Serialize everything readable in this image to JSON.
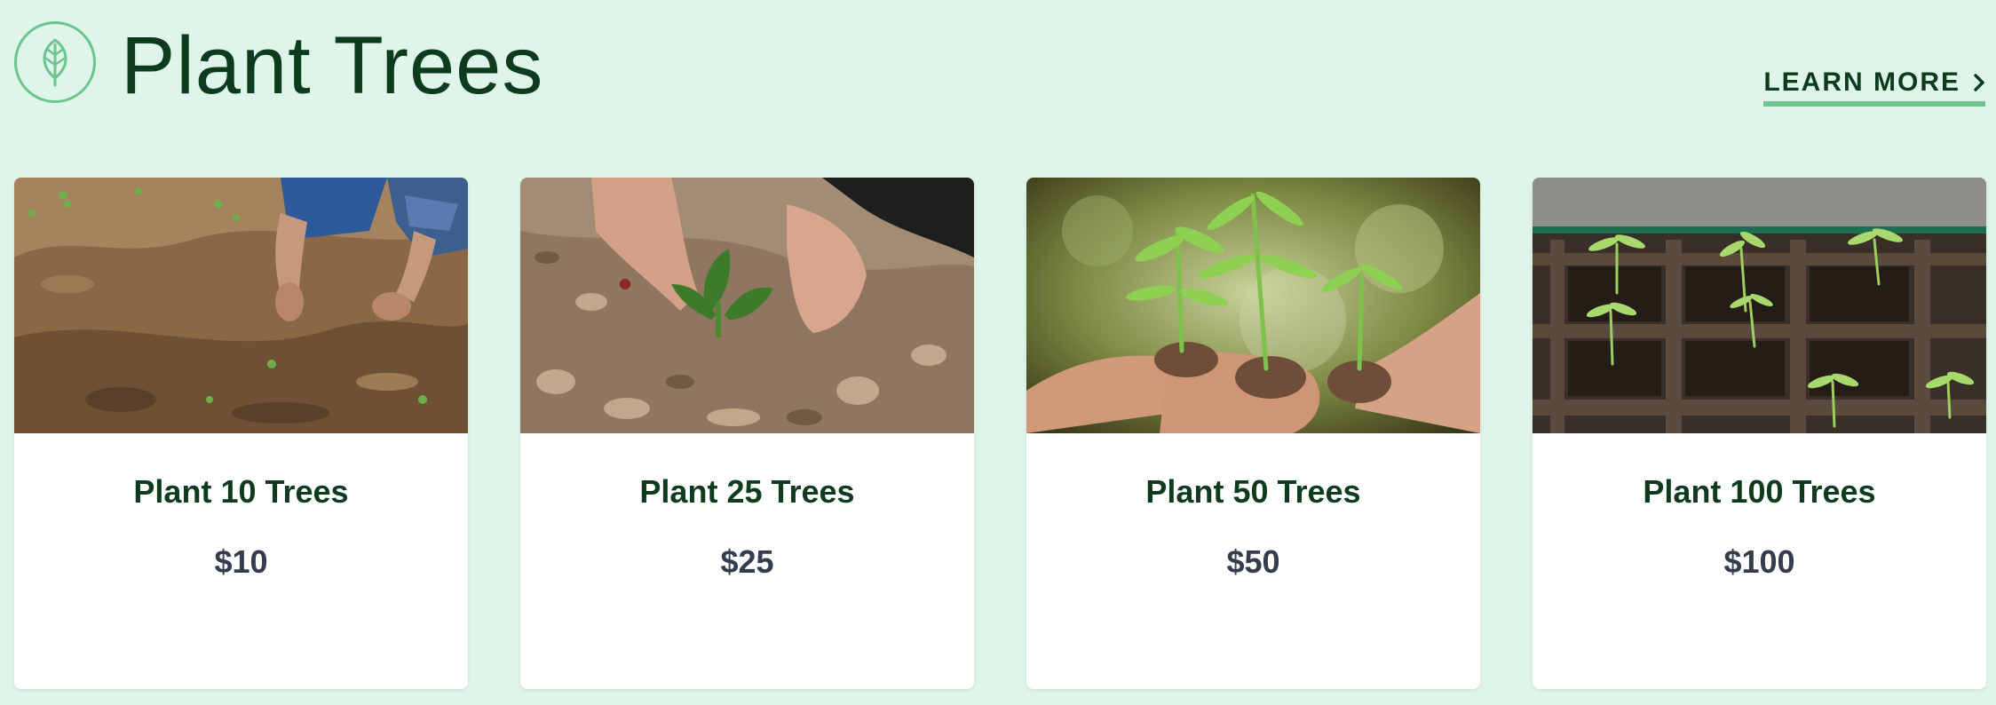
{
  "header": {
    "title": "Plant Trees",
    "icon": "leaf-icon",
    "learn_more_label": "LEARN MORE",
    "learn_more_icon": "chevron-right-icon"
  },
  "colors": {
    "background": "#e0f5e9",
    "accent": "#6bc58e",
    "title_text": "#0d3b1e",
    "price_text": "#333d4d",
    "card_background": "#ffffff"
  },
  "cards": [
    {
      "title": "Plant 10 Trees",
      "price": "$10",
      "image": "gardener-planting-in-soil-photo"
    },
    {
      "title": "Plant 25 Trees",
      "price": "$25",
      "image": "hands-planting-seedling-photo"
    },
    {
      "title": "Plant 50 Trees",
      "price": "$50",
      "image": "hands-holding-saplings-photo"
    },
    {
      "title": "Plant 100 Trees",
      "price": "$100",
      "image": "seedling-tray-photo"
    }
  ]
}
